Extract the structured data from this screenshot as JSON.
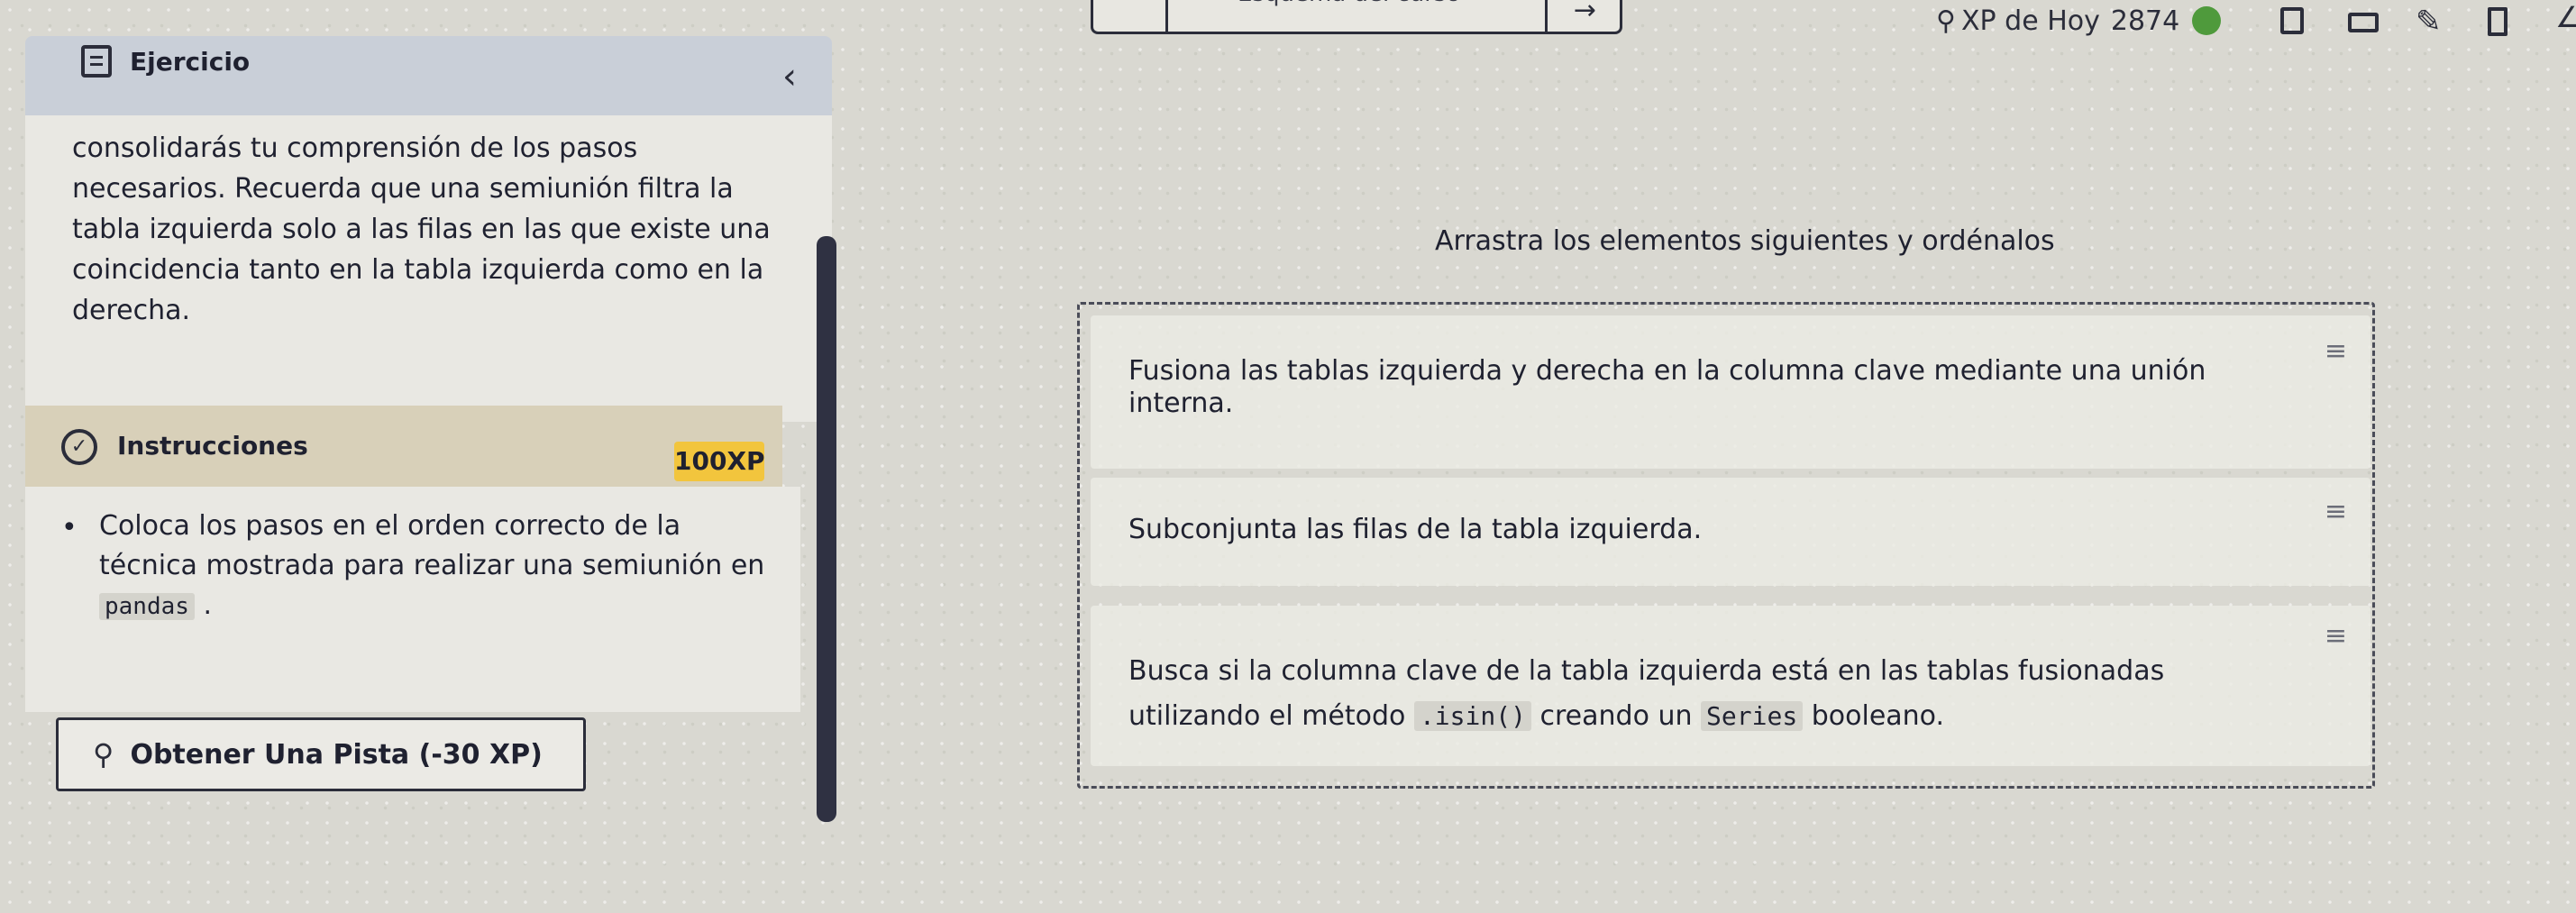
{
  "top_bar": {
    "tab_label": "Esquema del curso",
    "xp_label": "XP de Hoy",
    "xp_value": "2874"
  },
  "exercise": {
    "title": "Ejercicio",
    "body": "consolidarás tu comprensión de los pasos necesarios. Recuerda que una semiunión filtra la tabla izquierda solo a las filas en las que existe una coincidencia tanto en la tabla izquierda como en la derecha."
  },
  "instructions": {
    "title": "Instrucciones",
    "xp_badge": "100XP",
    "bullet_text": "Coloca los pasos en el orden correcto de la técnica mostrada para realizar una semiunión en",
    "bullet_code": "pandas",
    "bullet_end": "."
  },
  "hint": {
    "label": "Obtener Una Pista (-30 XP)"
  },
  "drag_area": {
    "prompt": "Arrastra los elementos siguientes y ordénalos",
    "items": [
      {
        "text": "Fusiona las tablas izquierda y derecha en la columna clave mediante una unión interna."
      },
      {
        "text": "Subconjunta las filas de la tabla izquierda."
      },
      {
        "text_start": "Busca si la columna clave de la tabla izquierda está en las tablas fusionadas utilizando el método",
        "code1": ".isin()",
        "text_mid": "creando un",
        "code2": "Series",
        "text_end": "booleano."
      }
    ]
  },
  "colors": {
    "accent_badge": "#f2c53d",
    "streak": "#4f9a3c",
    "scrollbar": "#2f3142"
  }
}
